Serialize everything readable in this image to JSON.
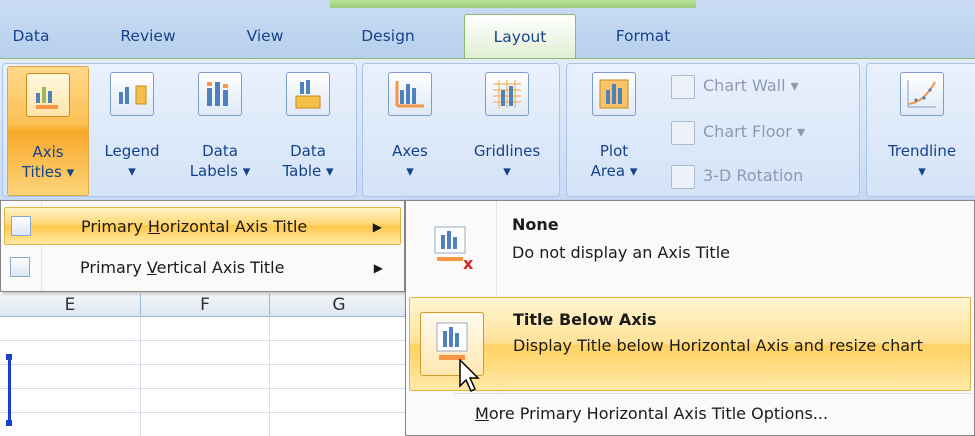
{
  "tabs": [
    {
      "id": "data",
      "label": "Data"
    },
    {
      "id": "review",
      "label": "Review"
    },
    {
      "id": "view",
      "label": "View"
    },
    {
      "id": "design",
      "label": "Design"
    },
    {
      "id": "layout",
      "label": "Layout",
      "active": true
    },
    {
      "id": "format",
      "label": "Format"
    }
  ],
  "ribbon": {
    "axis_titles": {
      "l1": "Axis",
      "l2": "Titles ▾"
    },
    "legend": {
      "l1": "Legend",
      "l2": "▾"
    },
    "data_labels": {
      "l1": "Data",
      "l2": "Labels ▾"
    },
    "data_table": {
      "l1": "Data",
      "l2": "Table ▾"
    },
    "axes": {
      "l1": "Axes",
      "l2": "▾"
    },
    "gridlines": {
      "l1": "Gridlines",
      "l2": "▾"
    },
    "plot_area": {
      "l1": "Plot",
      "l2": "Area ▾"
    },
    "chart_wall": "Chart Wall ▾",
    "chart_floor": "Chart Floor ▾",
    "rotation": "3-D Rotation",
    "trendline": {
      "l1": "Trendline",
      "l2": "▾"
    }
  },
  "sheet": {
    "columns": [
      "E",
      "F",
      "G"
    ]
  },
  "menu": {
    "horizontal": {
      "pre": "Primary ",
      "u": "H",
      "post": "orizontal Axis Title"
    },
    "vertical": {
      "pre": "Primary ",
      "u": "V",
      "post": "ertical Axis Title"
    }
  },
  "submenu": {
    "none": {
      "title": "None",
      "desc": "Do not display an Axis Title"
    },
    "below": {
      "title": "Title Below Axis",
      "desc": "Display Title below Horizontal Axis and resize chart"
    },
    "more": {
      "u": "M",
      "post": "ore Primary Horizontal Axis Title Options..."
    }
  },
  "colors": {
    "accent": "#ffd262",
    "ribbon": "#d2e2f6",
    "text": "#15428b"
  }
}
